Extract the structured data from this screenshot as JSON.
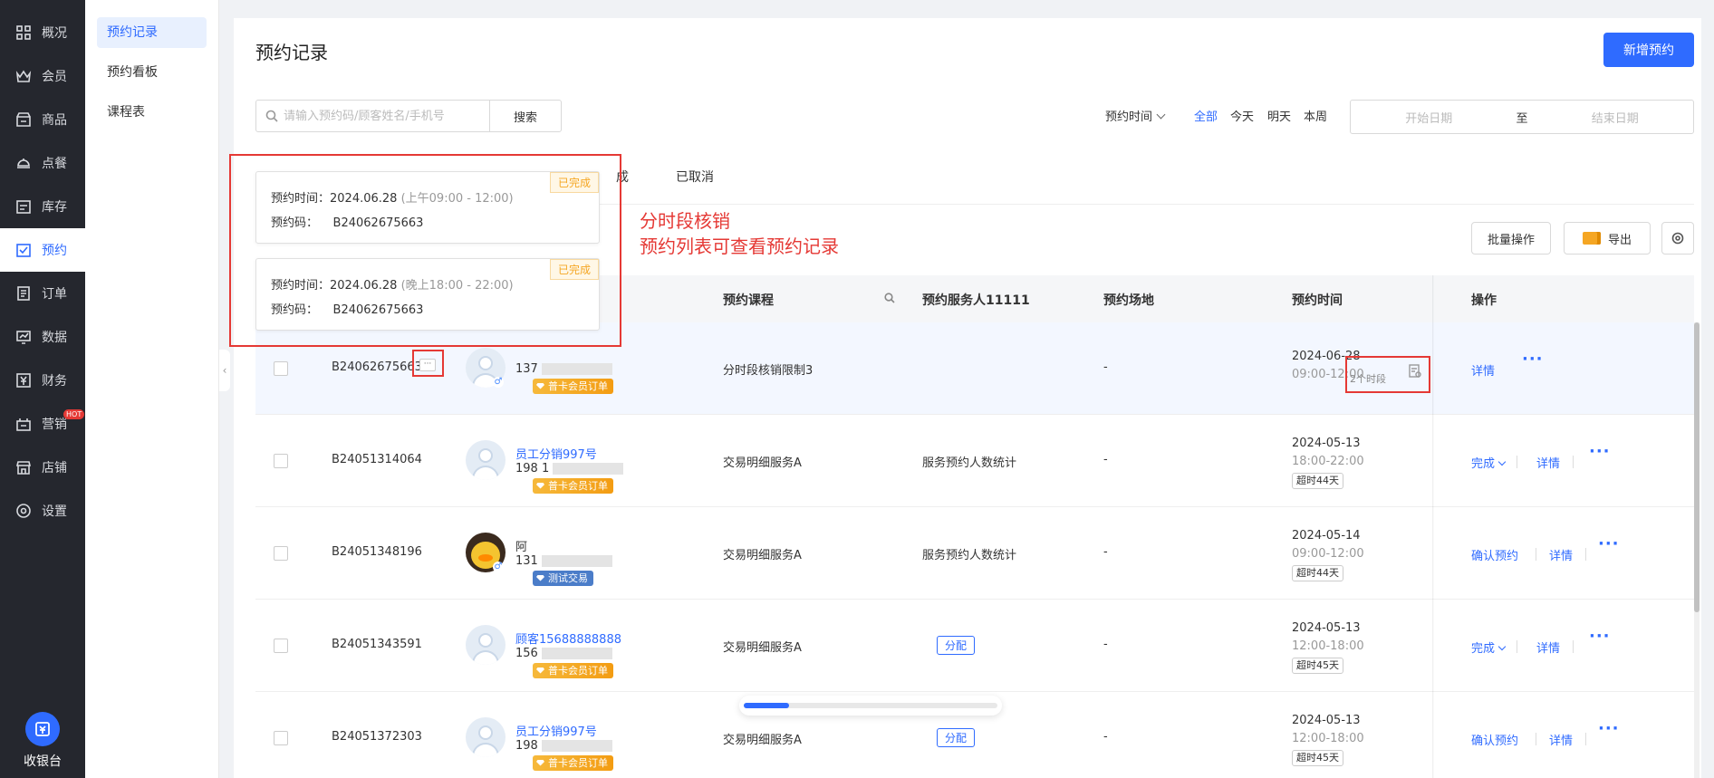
{
  "nav": {
    "items": [
      {
        "label": "概况",
        "icon": "grid-icon"
      },
      {
        "label": "会员",
        "icon": "crown-icon"
      },
      {
        "label": "商品",
        "icon": "store-icon"
      },
      {
        "label": "点餐",
        "icon": "dish-icon"
      },
      {
        "label": "库存",
        "icon": "inventory-icon"
      },
      {
        "label": "预约",
        "icon": "check-calendar-icon"
      },
      {
        "label": "订单",
        "icon": "order-icon"
      },
      {
        "label": "数据",
        "icon": "chart-icon"
      },
      {
        "label": "财务",
        "icon": "yen-icon"
      },
      {
        "label": "营销",
        "icon": "marketing-icon",
        "badge": "HOT"
      },
      {
        "label": "店铺",
        "icon": "shop-icon"
      },
      {
        "label": "设置",
        "icon": "settings-icon"
      }
    ],
    "active_index": 5,
    "cashier_label": "收银台"
  },
  "submenu": {
    "items": [
      "预约记录",
      "预约看板",
      "课程表"
    ],
    "active_index": 0
  },
  "page": {
    "title": "预约记录",
    "new_button": "新增预约"
  },
  "search": {
    "placeholder": "请输入预约码/顾客姓名/手机号",
    "button": "搜索"
  },
  "filter": {
    "time_label": "预约时间",
    "quick": [
      "全部",
      "今天",
      "明天",
      "本周"
    ],
    "quick_active": 0,
    "start_placeholder": "开始日期",
    "separator": "至",
    "end_placeholder": "结束日期"
  },
  "tabs": {
    "partial": "成",
    "cancelled": "已取消"
  },
  "toolbar": {
    "batch": "批量操作",
    "export": "导出"
  },
  "table": {
    "headers": {
      "course": "预约课程",
      "staff": "预约服务人11111",
      "venue": "预约场地",
      "time": "预约时间",
      "action": "操作"
    },
    "rows": [
      {
        "code": "B24062675663",
        "name": "",
        "phone_prefix": "137",
        "badge": "普卡会员订单",
        "badge_type": "gold",
        "course": "分时段核销限制3",
        "staff": "",
        "venue": "-",
        "date": "2024-06-28",
        "time": "09:00-12:00",
        "overtime": "",
        "segments": "2个时段",
        "actions": [
          "详情"
        ]
      },
      {
        "code": "B24051314064",
        "name": "员工分销997号",
        "phone_prefix": "198 1",
        "badge": "普卡会员订单",
        "badge_type": "gold",
        "course": "交易明细服务A",
        "staff": "服务预约人数统计",
        "venue": "-",
        "date": "2024-05-13",
        "time": "18:00-22:00",
        "overtime": "超时44天",
        "actions": [
          "完成",
          "详情"
        ]
      },
      {
        "code": "B24051348196",
        "name": "阿",
        "phone_prefix": "131",
        "badge": "测试交易",
        "badge_type": "blue",
        "course": "交易明细服务A",
        "staff": "服务预约人数统计",
        "venue": "-",
        "date": "2024-05-14",
        "time": "09:00-12:00",
        "overtime": "超时44天",
        "actions": [
          "确认预约",
          "详情"
        ]
      },
      {
        "code": "B24051343591",
        "name": "顾客15688888888",
        "phone_prefix": "156",
        "badge": "普卡会员订单",
        "badge_type": "gold",
        "course": "交易明细服务A",
        "staff_assign": "分配",
        "venue": "-",
        "date": "2024-05-13",
        "time": "12:00-18:00",
        "overtime": "超时45天",
        "actions": [
          "完成",
          "详情"
        ]
      },
      {
        "code": "B24051372303",
        "name": "员工分销997号",
        "phone_prefix": "198",
        "badge": "普卡会员订单",
        "badge_type": "gold",
        "course": "交易明细服务A",
        "staff_assign": "分配",
        "venue": "-",
        "date": "2024-05-13",
        "time": "12:00-18:00",
        "overtime": "超时45天",
        "actions": [
          "确认预约",
          "详情"
        ]
      }
    ]
  },
  "popover": {
    "cards": [
      {
        "time_label": "预约时间：",
        "date": "2024.06.28",
        "period": "(上午09:00 - 12:00)",
        "code_label": "预约码：",
        "code": "B24062675663",
        "status": "已完成"
      },
      {
        "time_label": "预约时间：",
        "date": "2024.06.28",
        "period": "(晚上18:00 - 22:00)",
        "code_label": "预约码：",
        "code": "B24062675663",
        "status": "已完成"
      }
    ]
  },
  "annotation": {
    "line1": "分时段核销",
    "line2": "预约列表可查看预约记录"
  },
  "progress": {
    "value": 0.18
  },
  "colors": {
    "primary": "#2f6bff",
    "nav_bg": "#25272e",
    "annotation_red": "#e53935",
    "warning": "#f5a623"
  }
}
